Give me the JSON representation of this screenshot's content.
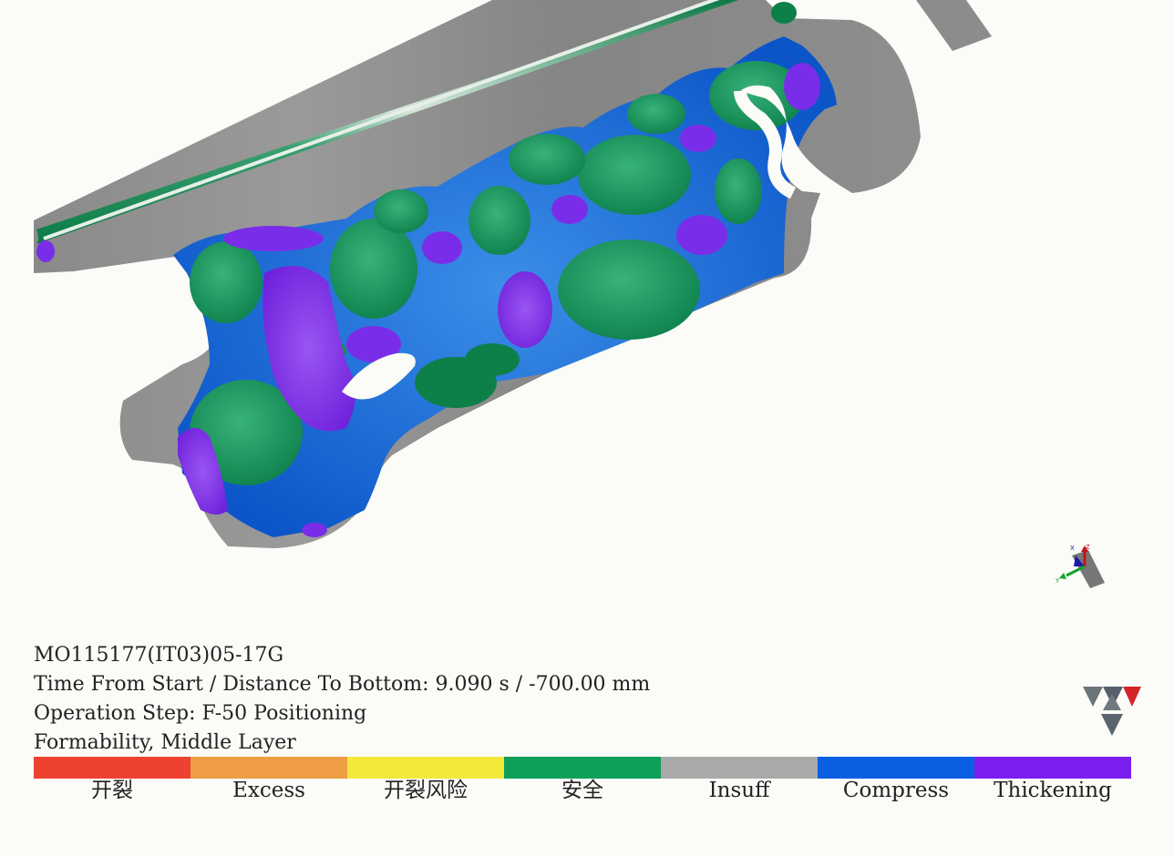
{
  "model_id": "MO115177(IT03)05-17G",
  "time_line": "Time From Start / Distance To Bottom: 9.090 s / -700.00 mm",
  "operation_line": "Operation Step: F-50 Positioning",
  "result_line": "Formability, Middle Layer",
  "legend": [
    {
      "label": "开裂",
      "color": "#ef4130"
    },
    {
      "label": "Excess",
      "color": "#ee9d45"
    },
    {
      "label": "开裂风险",
      "color": "#f4e83a"
    },
    {
      "label": "安全",
      "color": "#0ea05a"
    },
    {
      "label": "Insuff",
      "color": "#a9a9a9"
    },
    {
      "label": "Compress",
      "color": "#0b60e2"
    },
    {
      "label": "Thickening",
      "color": "#7a1ff0"
    }
  ],
  "axis_triad": {
    "x_label": "X",
    "z_label": "Z",
    "y_label": "Y"
  },
  "icons": {
    "triad": "axis-triad-icon",
    "logo": "brand-logo-icon"
  }
}
